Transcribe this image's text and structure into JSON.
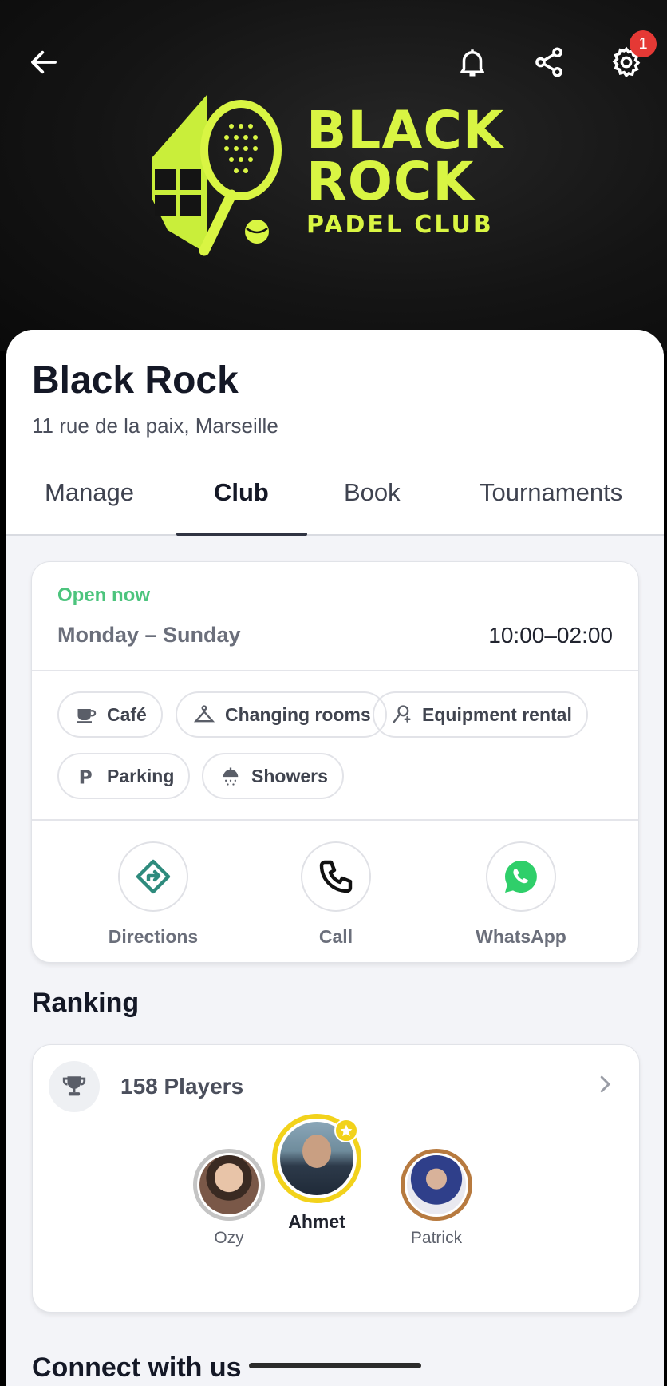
{
  "header": {
    "notification_count": "1",
    "icons": [
      "back-arrow-icon",
      "bell-icon",
      "share-icon",
      "gear-icon"
    ]
  },
  "logo": {
    "line1": "BLACK",
    "line2": "ROCK",
    "line3": "PADEL CLUB",
    "color": "#d9f543"
  },
  "club": {
    "name": "Black Rock",
    "address": "11 rue de la paix, Marseille"
  },
  "tabs": [
    {
      "label": "Manage",
      "active": false
    },
    {
      "label": "Club",
      "active": true
    },
    {
      "label": "Book",
      "active": false
    },
    {
      "label": "Tournaments",
      "active": false
    }
  ],
  "hours": {
    "status": "Open now",
    "days": "Monday – Sunday",
    "time": "10:00–02:00",
    "status_color": "#4cc47d"
  },
  "amenities": [
    {
      "label": "Café",
      "icon": "coffee-cup-icon"
    },
    {
      "label": "Changing rooms",
      "icon": "changing-room-icon"
    },
    {
      "label": "Equipment rental",
      "icon": "equipment-rental-icon"
    },
    {
      "label": "Parking",
      "icon": "parking-icon"
    },
    {
      "label": "Showers",
      "icon": "shower-icon"
    }
  ],
  "actions": [
    {
      "label": "Directions",
      "icon": "directions-icon",
      "color": "#2e8b7d"
    },
    {
      "label": "Call",
      "icon": "phone-icon",
      "color": "#111111"
    },
    {
      "label": "WhatsApp",
      "icon": "whatsapp-icon",
      "color": "#2fcf6a"
    }
  ],
  "ranking": {
    "title": "Ranking",
    "players_label": "158 Players",
    "podium": [
      {
        "name": "Ozy",
        "rank": 2,
        "ring_color": "#c4c4c4"
      },
      {
        "name": "Ahmet",
        "rank": 1,
        "ring_color": "#f2d21b"
      },
      {
        "name": "Patrick",
        "rank": 3,
        "ring_color": "#b77a3f"
      }
    ]
  },
  "connect": {
    "title": "Connect with us"
  }
}
